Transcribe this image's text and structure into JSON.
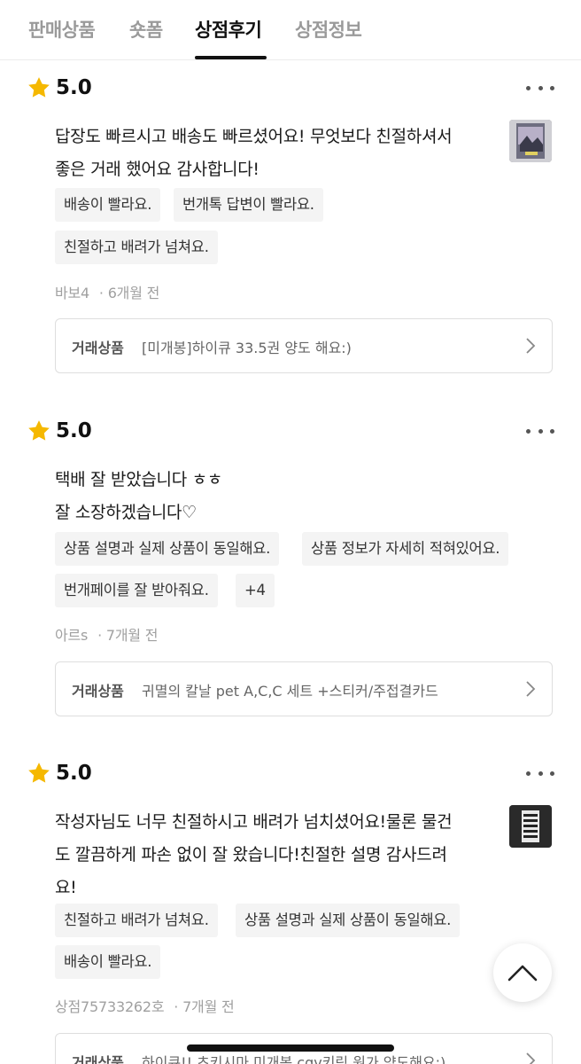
{
  "tabs": [
    {
      "label": "판매상품"
    },
    {
      "label": "숏폼"
    },
    {
      "label": "상점후기"
    },
    {
      "label": "상점정보"
    }
  ],
  "colors": {
    "star": "#f5b800",
    "active_tab": "#111111",
    "inactive_tab": "#9a9a9a"
  },
  "reviews": [
    {
      "rating": "5.0",
      "text_lines": [
        "답장도 빠르시고 배송도 빠르셨어요! 무엇보다 친절하셔서",
        "좋은 거래 했어요 감사합니다!"
      ],
      "tags": [
        "배송이 빨라요.",
        "번개톡 답변이 빨라요.",
        "친절하고 배려가 넘쳐요."
      ],
      "author": "바보4",
      "time": "· 6개월 전",
      "trade_label": "거래상품",
      "trade_item": "[미개봉]하이큐 33.5권 양도 해요:)"
    },
    {
      "rating": "5.0",
      "text_lines": [
        "택배 잘 받았습니다 ㅎㅎ",
        "잘 소장하겠습니다♡"
      ],
      "tags": [
        "상품 설명과 실제 상품이 동일해요.",
        "상품 정보가 자세히 적혀있어요.",
        "번개페이를 잘 받아줘요.",
        "+4"
      ],
      "author": "아르s",
      "time": "· 7개월 전",
      "trade_label": "거래상품",
      "trade_item": "귀멸의 칼날 pet A,C,C 세트 +스티커/주접결카드"
    },
    {
      "rating": "5.0",
      "text_lines": [
        "작성자님도 너무 친절하시고 배려가 넘치셨어요!물론 물건",
        "도 깔끔하게 파손 없이 잘 왔습니다!친절한 설명 감사드려",
        "요!"
      ],
      "tags": [
        "친절하고 배려가 넘쳐요.",
        "상품 설명과 실제 상품이 동일해요.",
        "배송이 빨라요."
      ],
      "author": "상점75733262호",
      "time": "· 7개월 전",
      "trade_label": "거래상품",
      "trade_item": "하이큐!! 츠키시마 미개봉 cgv키링 원가 양도해요:)"
    }
  ]
}
